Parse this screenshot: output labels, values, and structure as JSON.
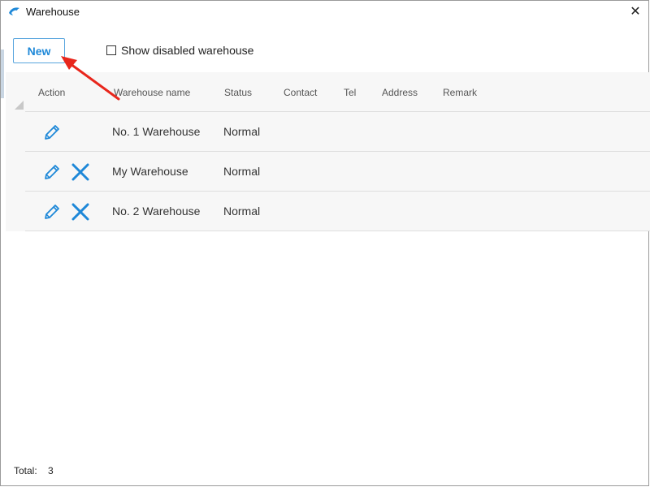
{
  "window": {
    "title": "Warehouse",
    "app_icon": "dolphin-icon",
    "close_icon": "close-icon",
    "close_glyph": "✕"
  },
  "toolbar": {
    "new_label": "New",
    "show_disabled_label": "Show disabled warehouse",
    "show_disabled_checked": false
  },
  "table": {
    "columns": [
      "Action",
      "Warehouse name",
      "Status",
      "Contact",
      "Tel",
      "Address",
      "Remark"
    ],
    "rows": [
      {
        "name": "No. 1 Warehouse",
        "status": "Normal",
        "contact": "",
        "tel": "",
        "address": "",
        "remark": "",
        "actions": [
          "edit-icon"
        ]
      },
      {
        "name": "My Warehouse",
        "status": "Normal",
        "contact": "",
        "tel": "",
        "address": "",
        "remark": "",
        "actions": [
          "edit-icon",
          "delete-icon"
        ]
      },
      {
        "name": "No. 2 Warehouse",
        "status": "Normal",
        "contact": "",
        "tel": "",
        "address": "",
        "remark": "",
        "actions": [
          "edit-icon",
          "delete-icon"
        ]
      }
    ]
  },
  "footer": {
    "total_label": "Total:",
    "total_count": "3"
  },
  "colors": {
    "accent": "#1e88d8",
    "annotation_arrow": "#e8261c",
    "grid_background": "#f7f7f7"
  }
}
